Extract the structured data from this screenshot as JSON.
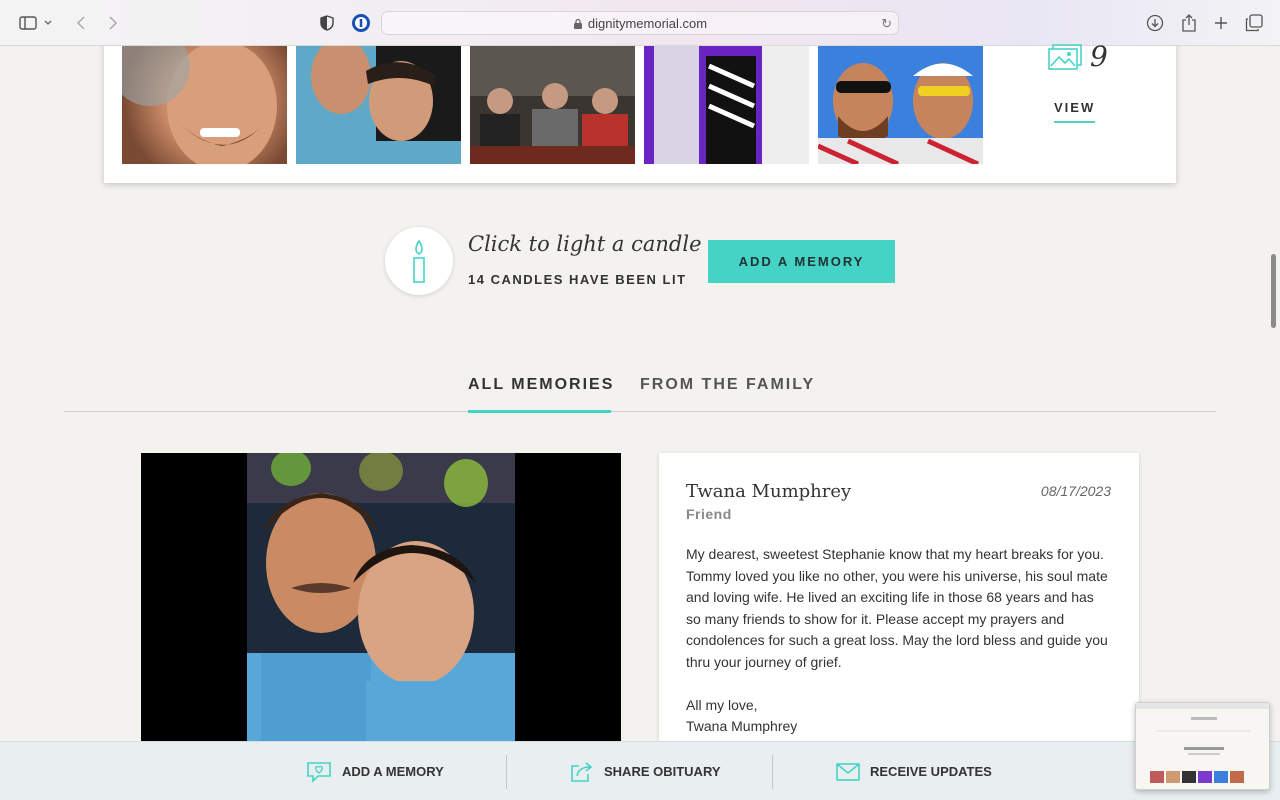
{
  "browser": {
    "url": "dignitymemorial.com",
    "icons": [
      "sidebar-icon",
      "chevron-down-icon",
      "back-icon",
      "forward-icon",
      "shield-icon",
      "password-manager-icon",
      "lock-icon",
      "reload-icon",
      "download-icon",
      "share-icon",
      "new-tab-icon",
      "tabs-overview-icon"
    ]
  },
  "gallery": {
    "photo_count": "9",
    "view_label": "VIEW",
    "thumbnails": [
      "photo-1",
      "photo-2",
      "photo-3",
      "photo-4",
      "photo-5"
    ]
  },
  "candle": {
    "title": "Click to light a candle",
    "count_text": "14 CANDLES HAVE BEEN LIT",
    "add_memory_label": "ADD A MEMORY"
  },
  "tabs": [
    {
      "label": "ALL MEMORIES",
      "active": true
    },
    {
      "label": "FROM THE FAMILY",
      "active": false
    }
  ],
  "memory": {
    "name": "Twana Mumphrey",
    "relationship": "Friend",
    "date": "08/17/2023",
    "body": "My dearest, sweetest Stephanie know that my heart breaks for you. Tommy loved you like no other, you were his universe, his soul mate and loving wife. He lived an exciting life in those 68 years and has so many friends to show for it. Please accept my prayers and condolences for such a great loss. May the lord bless and guide you thru your journey of grief.\n\nAll my love,\nTwana Mumphrey"
  },
  "bottom_bar": {
    "add_memory": "ADD A MEMORY",
    "share_obituary": "SHARE OBITUARY",
    "receive_updates": "RECEIVE UPDATES"
  },
  "colors": {
    "accent": "#45d3c6",
    "background": "#f3f2ef"
  }
}
